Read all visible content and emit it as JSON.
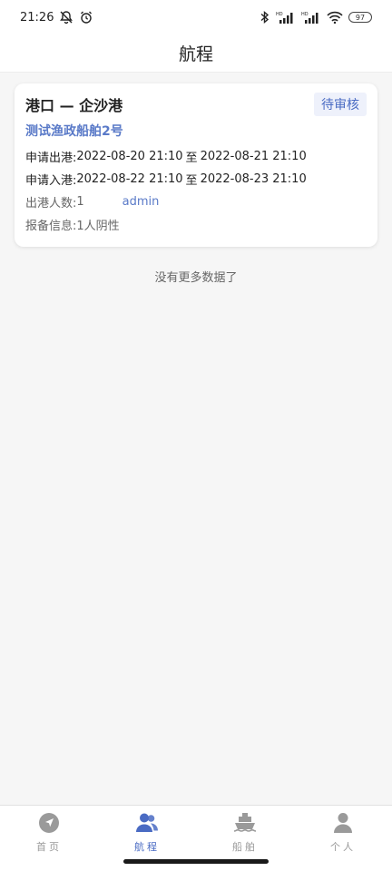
{
  "status_bar": {
    "time": "21:26",
    "battery": "97"
  },
  "header": {
    "title": "航程"
  },
  "voyage": {
    "route": "港口 — 企沙港",
    "status": "待审核",
    "ship_name": "测试渔政船舶2号",
    "depart_label": "申请出港:",
    "depart_start": "2022-08-20 21:10",
    "depart_to": "至",
    "depart_end": "2022-08-21 21:10",
    "arrive_label": "申请入港:",
    "arrive_start": "2022-08-22 21:10",
    "arrive_to": "至",
    "arrive_end": "2022-08-23 21:10",
    "count_label": "出港人数:",
    "count_value": "1",
    "user": "admin",
    "report_label": "报备信息:",
    "report_value": "1人阴性"
  },
  "list_footer": "没有更多数据了",
  "tabs": [
    {
      "label": "首页",
      "icon": "navigation-icon",
      "active": false
    },
    {
      "label": "航程",
      "icon": "users-icon",
      "active": true
    },
    {
      "label": "船舶",
      "icon": "ship-icon",
      "active": false
    },
    {
      "label": "个人",
      "icon": "person-icon",
      "active": false
    }
  ],
  "colors": {
    "accent": "#4a6bc3",
    "inactive": "#9a9a9a"
  }
}
